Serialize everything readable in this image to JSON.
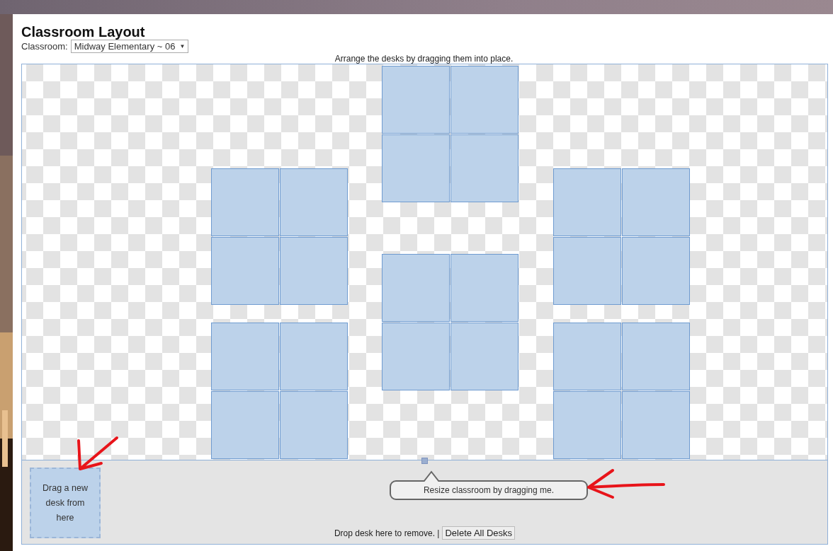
{
  "title": "Classroom Layout",
  "classroom": {
    "label": "Classroom:",
    "value": "Midway Elementary ~ 06",
    "caret": "▼"
  },
  "instructions": "Arrange the desks by dragging them into place.",
  "new_desk": {
    "label": "Drag a new desk from here"
  },
  "resize_tip": "Resize classroom by dragging me.",
  "drop_text": "Drop desk here to remove. |",
  "delete_button": "Delete All Desks"
}
